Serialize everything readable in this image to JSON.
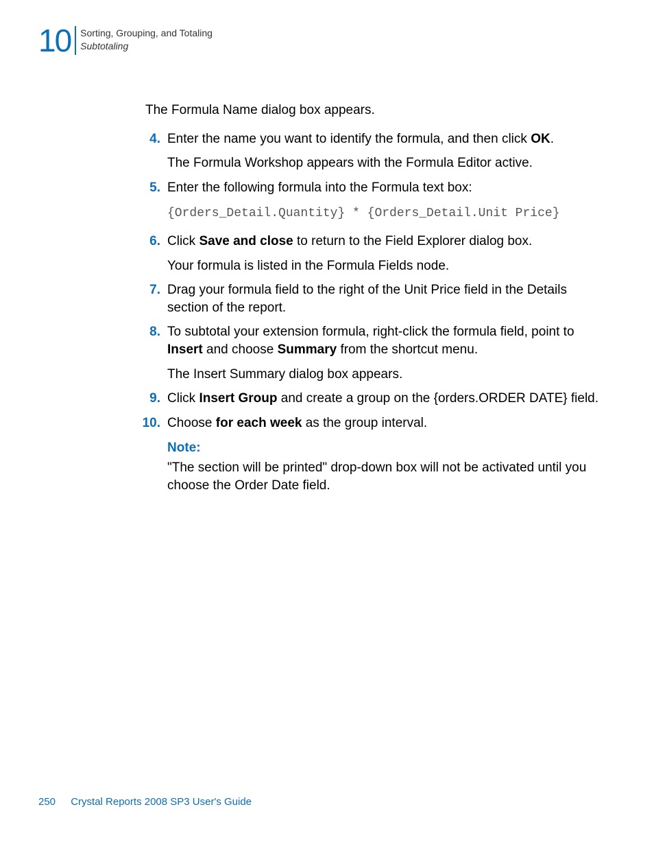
{
  "header": {
    "chapter_number": "10",
    "chapter_title": "Sorting, Grouping, and Totaling",
    "section_title": "Subtotaling"
  },
  "content": {
    "intro": "The Formula Name dialog box appears.",
    "steps": [
      {
        "num": "4.",
        "text_parts": [
          "Enter the name you want to identify the formula, and then click ",
          "OK",
          "."
        ],
        "after": "The Formula Workshop appears with the Formula Editor active."
      },
      {
        "num": "5.",
        "text_parts": [
          "Enter the following formula into the Formula text box:"
        ],
        "code": "{Orders_Detail.Quantity} * {Orders_Detail.Unit Price}"
      },
      {
        "num": "6.",
        "text_parts": [
          "Click ",
          "Save and close",
          " to return to the Field Explorer dialog box."
        ],
        "after": "Your formula is listed in the Formula Fields node."
      },
      {
        "num": "7.",
        "text_parts": [
          "Drag your formula field to the right of the Unit Price field in the Details section of the report."
        ]
      },
      {
        "num": "8.",
        "text_parts": [
          "To subtotal your extension formula, right-click the formula field, point to ",
          "Insert",
          " and choose ",
          "Summary",
          " from the shortcut menu."
        ],
        "after": "The Insert Summary dialog box appears."
      },
      {
        "num": "9.",
        "text_parts": [
          "Click ",
          "Insert Group",
          " and create a group on the {orders.ORDER DATE} field."
        ]
      },
      {
        "num": "10.",
        "text_parts": [
          "Choose ",
          "for each week",
          " as the group interval."
        ]
      }
    ],
    "note_label": "Note:",
    "note_body": "\"The section will be printed\" drop-down box will not be activated until you choose the Order Date field."
  },
  "footer": {
    "page_number": "250",
    "doc_title": "Crystal Reports 2008 SP3 User's Guide"
  }
}
